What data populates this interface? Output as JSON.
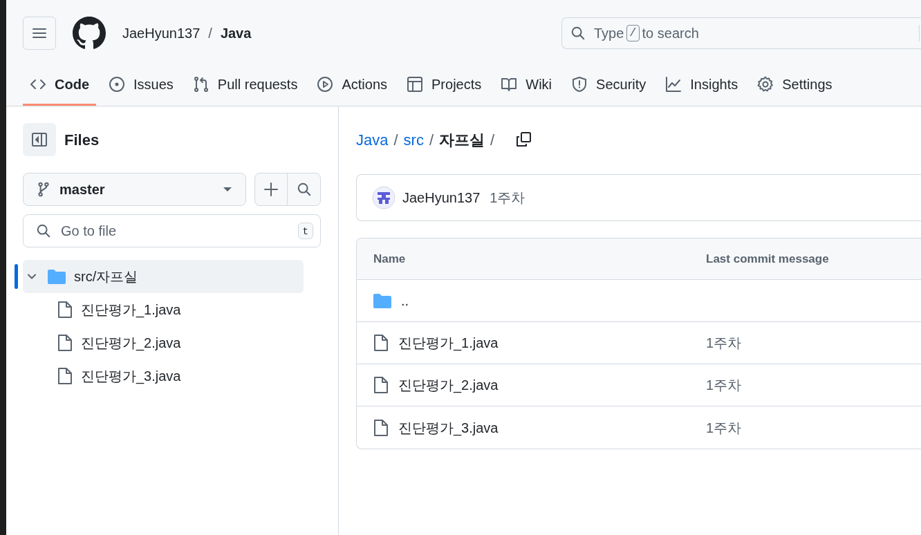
{
  "header": {
    "owner": "JaeHyun137",
    "separator": "/",
    "repo": "Java",
    "search": {
      "placeholder_before": "Type",
      "key": "/",
      "placeholder_after": "to search"
    }
  },
  "tabs": [
    {
      "label": "Code",
      "kind": "code",
      "selected": true
    },
    {
      "label": "Issues",
      "kind": "issues",
      "selected": false
    },
    {
      "label": "Pull requests",
      "kind": "pull",
      "selected": false
    },
    {
      "label": "Actions",
      "kind": "actions",
      "selected": false
    },
    {
      "label": "Projects",
      "kind": "projects",
      "selected": false
    },
    {
      "label": "Wiki",
      "kind": "wiki",
      "selected": false
    },
    {
      "label": "Security",
      "kind": "security",
      "selected": false
    },
    {
      "label": "Insights",
      "kind": "insights",
      "selected": false
    },
    {
      "label": "Settings",
      "kind": "settings",
      "selected": false
    }
  ],
  "sidebar": {
    "title": "Files",
    "branch": "master",
    "file_search": {
      "placeholder": "Go to file",
      "shortcut": "t"
    },
    "tree": [
      {
        "label": "src/자프실",
        "kind": "folder",
        "expanded": true,
        "selected": true,
        "children": [
          {
            "label": "진단평가_1.java",
            "kind": "file",
            "selected": false
          },
          {
            "label": "진단평가_2.java",
            "kind": "file",
            "selected": false
          },
          {
            "label": "진단평가_3.java",
            "kind": "file",
            "selected": false
          }
        ]
      }
    ]
  },
  "breadcrumb": [
    {
      "label": "Java",
      "link": true
    },
    {
      "label": "src",
      "link": true
    },
    {
      "label": "자프실",
      "link": false
    }
  ],
  "breadcrumb_separator": "/",
  "latest_commit": {
    "author": "JaeHyun137",
    "message": "1주차"
  },
  "table": {
    "columns": [
      "Name",
      "Last commit message"
    ],
    "rows": [
      {
        "kind": "parent",
        "name": ".."
      },
      {
        "kind": "file",
        "name": "진단평가_1.java",
        "message": "1주차"
      },
      {
        "kind": "file",
        "name": "진단평가_2.java",
        "message": "1주차"
      },
      {
        "kind": "file",
        "name": "진단평가_3.java",
        "message": "1주차"
      }
    ]
  }
}
